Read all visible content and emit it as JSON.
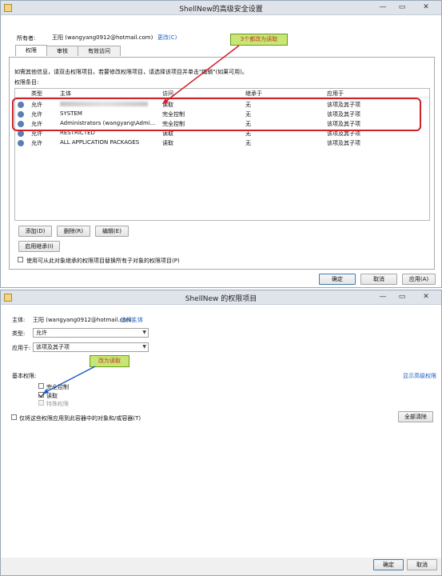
{
  "win1": {
    "title": "ShellNew的高级安全设置",
    "owner_label": "所有者:",
    "owner_value": "王阳 (wangyang0912@hotmail.com)",
    "owner_change": "更改(C)",
    "tabs": [
      "权限",
      "审核",
      "有效访问"
    ],
    "info_text": "如需其他信息，请双击权限项目。若要修改权限项目，请选择该项目并单击\"编辑\"(如果可用)。",
    "entries_label": "权限条目:",
    "columns": [
      "类型",
      "主体",
      "访问",
      "继承于",
      "应用于"
    ],
    "rows": [
      {
        "type": "允许",
        "principal": "",
        "access": "读取",
        "inherit": "无",
        "apply": "该项及其子项"
      },
      {
        "type": "允许",
        "principal": "SYSTEM",
        "access": "完全控制",
        "inherit": "无",
        "apply": "该项及其子项"
      },
      {
        "type": "允许",
        "principal": "Administrators (wangyang\\Admi...",
        "access": "完全控制",
        "inherit": "无",
        "apply": "该项及其子项"
      },
      {
        "type": "允许",
        "principal": "RESTRICTED",
        "access": "读取",
        "inherit": "无",
        "apply": "该项及其子项"
      },
      {
        "type": "允许",
        "principal": "ALL APPLICATION PACKAGES",
        "access": "读取",
        "inherit": "无",
        "apply": "该项及其子项"
      }
    ],
    "btn_add": "添加(D)",
    "btn_delete": "删除(R)",
    "btn_edit": "编辑(E)",
    "btn_enable_inherit": "启用继承(I)",
    "replace_child": "使用可从此对象继承的权限项目替换所有子对象的权限项目(P)",
    "btn_ok": "确定",
    "btn_cancel": "取消",
    "btn_apply": "应用(A)",
    "callout": "3个都改为读取"
  },
  "win2": {
    "title": "ShellNew 的权限项目",
    "principal_label": "主体:",
    "principal_value": "王阳 (wangyang0912@hotmail.com)",
    "select_principal": "选择主体",
    "type_label": "类型:",
    "type_value": "允许",
    "apply_label": "应用于:",
    "apply_value": "该项及其子项",
    "basic_perms": "基本权限:",
    "show_advanced": "显示高级权限",
    "perm_full": "完全控制",
    "perm_read": "读取",
    "perm_special": "特殊权限",
    "only_apply": "仅将这些权限应用到此容器中的对象和/或容器(T)",
    "clear_all": "全部清除",
    "btn_ok": "确定",
    "btn_cancel": "取消",
    "callout": "改为读取"
  },
  "colors": {
    "annotation_red": "#d0202a",
    "callout_green": "#c8e673",
    "link_blue": "#1a5fc4"
  }
}
